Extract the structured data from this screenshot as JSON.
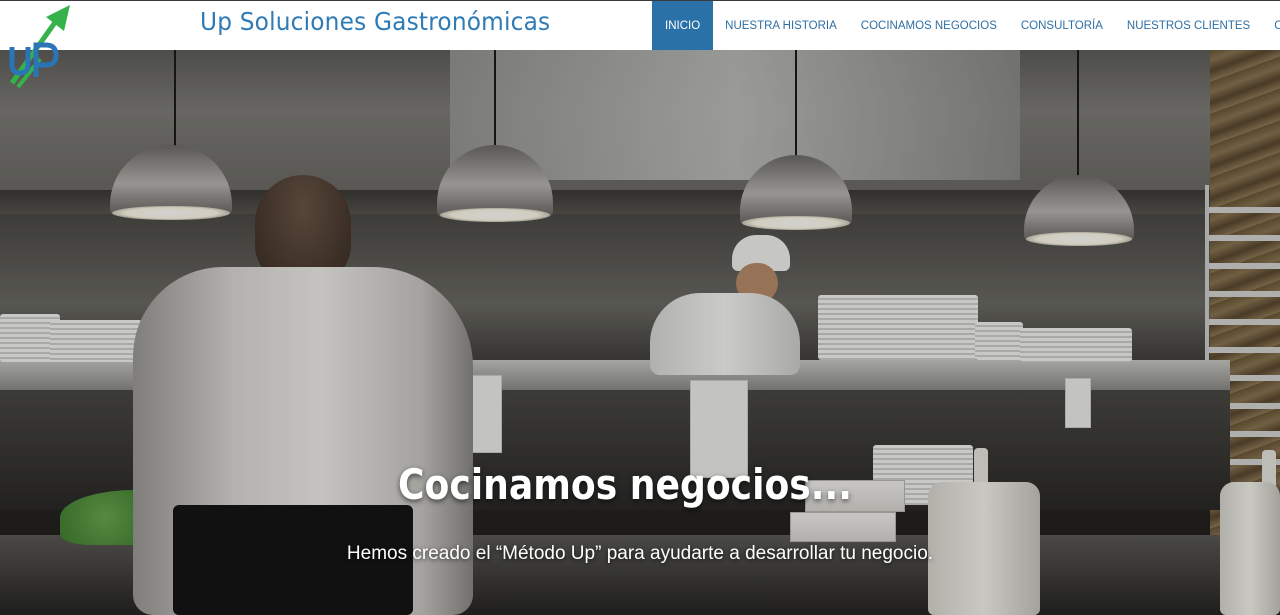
{
  "brand": {
    "logo_icon": "up-arrow-logo-icon",
    "logo_text": "UP",
    "name": "Up Soluciones Gastronómicas",
    "colors": {
      "primary": "#2e7bb6",
      "logo_green": "#35b34a",
      "logo_blue": "#2a74b8"
    }
  },
  "nav": {
    "items": [
      {
        "label": "INICIO",
        "active": true
      },
      {
        "label": "NUESTRA HISTORIA",
        "active": false
      },
      {
        "label": "COCINAMOS NEGOCIOS",
        "active": false
      },
      {
        "label": "CONSULTORÍA",
        "active": false
      },
      {
        "label": "NUESTROS CLIENTES",
        "active": false
      },
      {
        "label": "CONTACTO",
        "active": false
      }
    ],
    "active_color": "#2a71a7",
    "text_color": "#2e6fa3"
  },
  "hero": {
    "title": "Cocinamos negocios...",
    "subtitle": "Hemos creado el “Método Up” para ayudarte a desarrollar tu negocio."
  }
}
